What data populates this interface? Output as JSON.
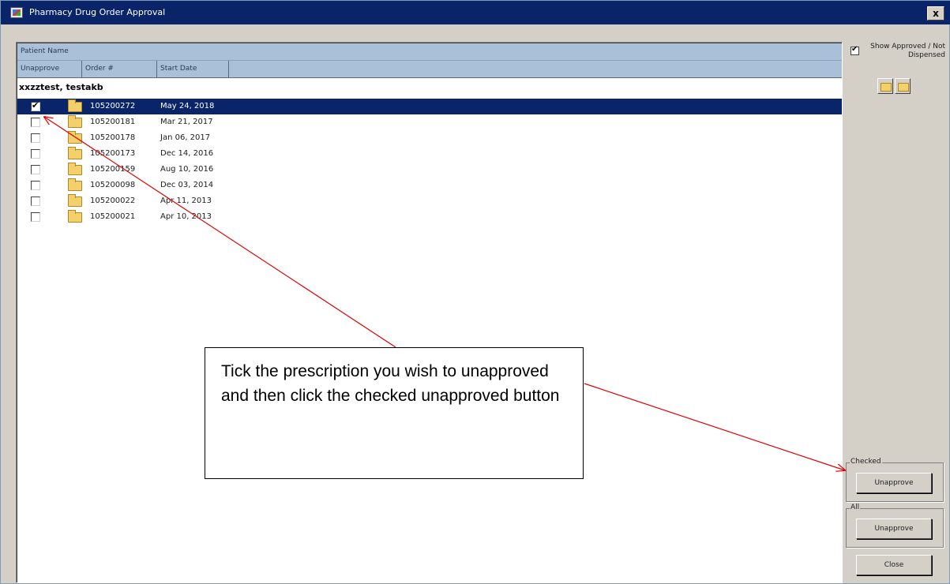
{
  "window": {
    "title": "Pharmacy Drug Order Approval",
    "close_label": "x"
  },
  "list": {
    "header_patient": "Patient Name",
    "columns": [
      "Unapprove",
      "Order #",
      "Start Date"
    ],
    "patient_name": "xxzztest, testakb",
    "rows": [
      {
        "order": "105200272",
        "date": "May 24, 2018",
        "checked": true,
        "selected": true
      },
      {
        "order": "105200181",
        "date": "Mar 21, 2017",
        "checked": false,
        "selected": false
      },
      {
        "order": "105200178",
        "date": "Jan 06, 2017",
        "checked": false,
        "selected": false
      },
      {
        "order": "105200173",
        "date": "Dec 14, 2016",
        "checked": false,
        "selected": false
      },
      {
        "order": "105200159",
        "date": "Aug 10, 2016",
        "checked": false,
        "selected": false
      },
      {
        "order": "105200098",
        "date": "Dec 03, 2014",
        "checked": false,
        "selected": false
      },
      {
        "order": "105200022",
        "date": "Apr 11, 2013",
        "checked": false,
        "selected": false
      },
      {
        "order": "105200021",
        "date": "Apr 10, 2013",
        "checked": false,
        "selected": false
      }
    ]
  },
  "side": {
    "show_approved_label": "Show Approved / Not Dispensed",
    "show_approved_checked": true,
    "checked_group_label": "Checked",
    "checked_unapprove_label": "Unapprove",
    "all_group_label": "All",
    "all_unapprove_label": "Unapprove",
    "close_label": "Close"
  },
  "callout": {
    "text": "Tick the prescription you wish to unapproved and then click the checked unapproved button"
  },
  "colors": {
    "titlebar": "#0a246a",
    "selection": "#0a246a",
    "header": "#aac0d8",
    "arrow": "#e00000"
  }
}
